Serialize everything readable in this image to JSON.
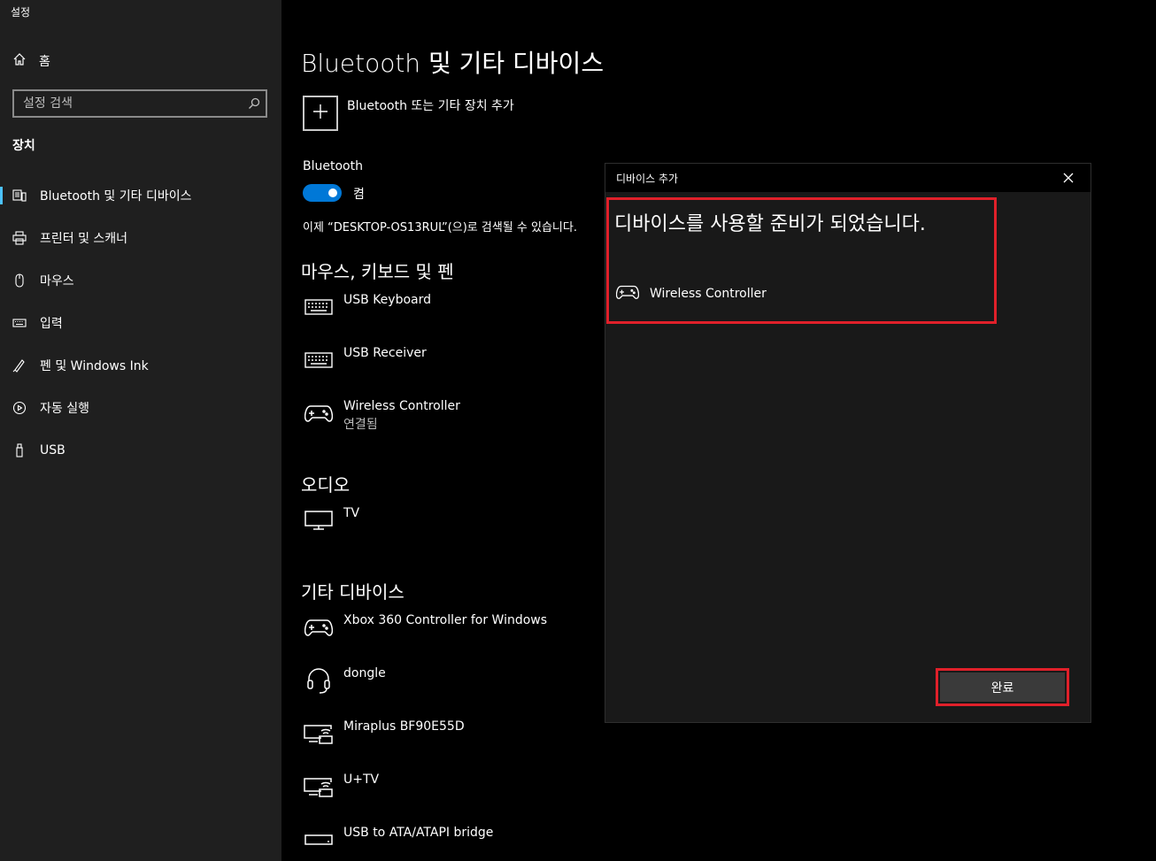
{
  "window": {
    "title": "설정"
  },
  "sidebar": {
    "home_label": "홈",
    "search_placeholder": "설정 검색",
    "section_title": "장치",
    "items": [
      {
        "label": "Bluetooth 및 기타 디바이스",
        "icon": "bluetooth-devices-icon",
        "active": true
      },
      {
        "label": "프린터 및 스캐너",
        "icon": "printer-icon"
      },
      {
        "label": "마우스",
        "icon": "mouse-icon"
      },
      {
        "label": "입력",
        "icon": "keyboard-icon"
      },
      {
        "label": "펜 및 Windows Ink",
        "icon": "pen-icon"
      },
      {
        "label": "자동 실행",
        "icon": "autoplay-icon"
      },
      {
        "label": "USB",
        "icon": "usb-icon"
      }
    ]
  },
  "main": {
    "title": "Bluetooth 및 기타 디바이스",
    "add_device_label": "Bluetooth 또는 기타 장치 추가",
    "bluetooth": {
      "label": "Bluetooth",
      "toggle_state": "켬",
      "discoverable_text": "이제 “DESKTOP-OS13RUL”(으)로 검색될 수 있습니다."
    },
    "groups": {
      "mouse_keyboard_pen": {
        "title": "마우스, 키보드 및 펜",
        "devices": [
          {
            "name": "USB Keyboard",
            "icon": "keyboard-icon"
          },
          {
            "name": "USB Receiver",
            "icon": "keyboard-icon"
          },
          {
            "name": "Wireless Controller",
            "status": "연결됨",
            "icon": "gamepad-icon"
          }
        ]
      },
      "audio": {
        "title": "오디오",
        "devices": [
          {
            "name": "TV",
            "icon": "monitor-icon"
          }
        ]
      },
      "other": {
        "title": "기타 디바이스",
        "devices": [
          {
            "name": "Xbox 360 Controller for Windows",
            "icon": "gamepad-icon"
          },
          {
            "name": "dongle",
            "icon": "headset-icon"
          },
          {
            "name": "Miraplus BF90E55D",
            "icon": "wireless-display-icon"
          },
          {
            "name": "U+TV",
            "icon": "wireless-display-icon"
          },
          {
            "name": "USB to ATA/ATAPI bridge",
            "icon": "drive-icon"
          }
        ]
      }
    }
  },
  "dialog": {
    "title": "디바이스 추가",
    "message": "디바이스를 사용할 준비가 되었습니다.",
    "device_name": "Wireless Controller",
    "done_label": "완료",
    "highlight_color": "#e0202a"
  },
  "colors": {
    "accent": "#0078d7",
    "sidebar_bg": "#1f1f1f",
    "dialog_bg": "#191919"
  }
}
